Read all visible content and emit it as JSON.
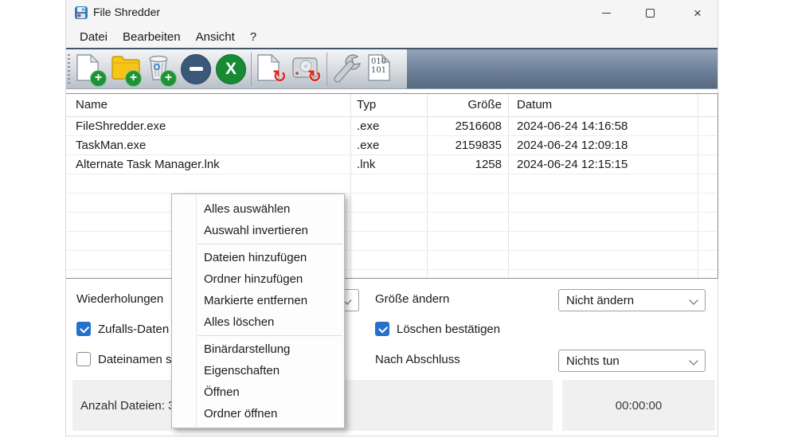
{
  "window": {
    "title": "File Shredder"
  },
  "menubar": {
    "items": [
      "Datei",
      "Bearbeiten",
      "Ansicht",
      "?"
    ]
  },
  "toolbar": {
    "icons": [
      "add-files",
      "add-folder",
      "add-recycle-bin",
      "remove-selected",
      "clear-list",
      "shred-files",
      "shred-free-space",
      "settings-wrench",
      "binary-view"
    ],
    "binary_line1": "010",
    "binary_line2": "101"
  },
  "table": {
    "columns": [
      "Name",
      "Typ",
      "Größe",
      "Datum"
    ],
    "rows": [
      {
        "name": "FileShredder.exe",
        "typ": ".exe",
        "groesse": "2516608",
        "datum": "2024-06-24 14:16:58"
      },
      {
        "name": "TaskMan.exe",
        "typ": ".exe",
        "groesse": "2159835",
        "datum": "2024-06-24 12:09:18"
      },
      {
        "name": "Alternate Task Manager.lnk",
        "typ": ".lnk",
        "groesse": "1258",
        "datum": "2024-06-24 12:15:15"
      }
    ]
  },
  "context_menu": {
    "items": [
      "Alles auswählen",
      "Auswahl invertieren",
      "Dateien hinzufügen",
      "Ordner hinzufügen",
      "Markierte entfernen",
      "Alles löschen",
      "Binärdarstellung",
      "Eigenschaften",
      "Öffnen",
      "Ordner öffnen"
    ]
  },
  "options": {
    "repeats": {
      "label": "Wiederholungen",
      "value": ""
    },
    "resize": {
      "label": "Größe ändern",
      "value": "Nicht ändern"
    },
    "after": {
      "label": "Nach Abschluss",
      "value": "Nichts tun"
    },
    "random_data": {
      "label": "Zufalls-Daten",
      "checked": true
    },
    "confirm_delete": {
      "label": "Löschen bestätigen",
      "checked": true
    },
    "filenames": {
      "label": "Dateinamen s",
      "checked": false
    }
  },
  "status": {
    "files_label": "Anzahl Dateien: 3",
    "timer": "00:00:00"
  },
  "colors": {
    "accent_blue": "#2471cc",
    "toolbar_blue": "#6d8099",
    "badge_green": "#1f9237",
    "badge_red": "#dd2a1d",
    "circle_navy": "#3a5878",
    "circle_green": "#188a34"
  }
}
